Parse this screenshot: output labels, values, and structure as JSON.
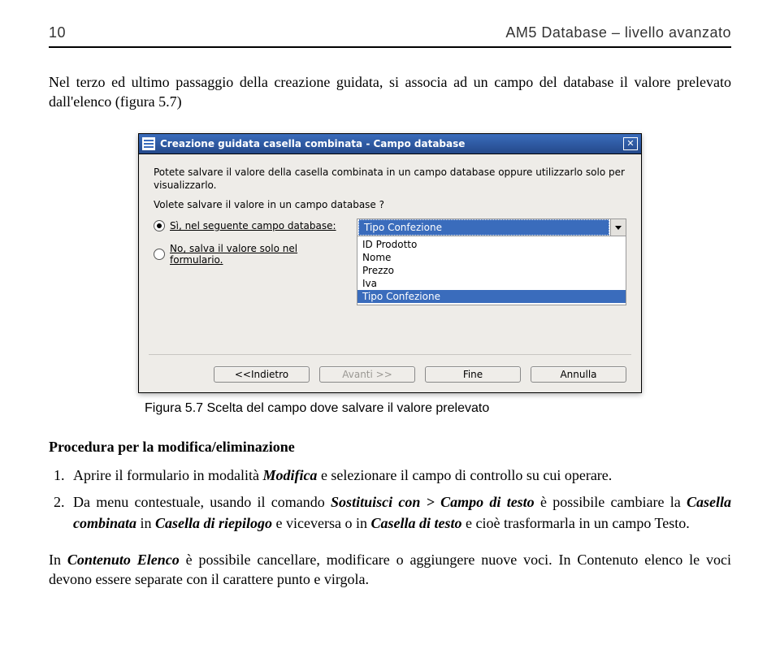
{
  "header": {
    "page_number": "10",
    "doc_title": "AM5 Database – livello avanzato"
  },
  "intro_paragraph": "Nel terzo ed ultimo passaggio della creazione guidata, si associa ad un campo del database il valore prelevato dall'elenco (figura 5.7)",
  "dialog": {
    "title": "Creazione guidata casella combinata - Campo database",
    "line1": "Potete salvare il valore della casella combinata in un campo database oppure utilizzarlo solo per visualizzarlo.",
    "line2": "Volete salvare il valore in un campo database ?",
    "radio_yes": "Sì, nel seguente campo database:",
    "radio_no": "No, salva il valore solo nel formulario.",
    "combo_selected": "Tipo Confezione",
    "combo_items": [
      "ID Prodotto",
      "Nome",
      "Prezzo",
      "Iva",
      "Tipo Confezione"
    ],
    "buttons": {
      "back": "<<Indietro",
      "next": "Avanti >>",
      "finish": "Fine",
      "cancel": "Annulla"
    }
  },
  "caption": "Figura 5.7 Scelta del campo dove salvare il valore prelevato",
  "procedure": {
    "heading": "Procedura per la modifica/eliminazione",
    "step1_a": "Aprire il formulario in modalità ",
    "step1_b": "Modifica",
    "step1_c": " e selezionare il campo di controllo su cui operare.",
    "step2_a": "Da menu contestuale, usando il comando ",
    "step2_b": "Sostituisci con > Campo di testo",
    "step2_c": " è possibile cambiare la ",
    "step2_d": "Casella combinata",
    "step2_e": " in ",
    "step2_f": "Casella di riepilogo",
    "step2_g": " e viceversa o in ",
    "step2_h": "Casella di testo",
    "step2_i": " e cioè trasformarla in un campo Testo."
  },
  "closing": {
    "a": "In ",
    "b": "Contenuto Elenco",
    "c": " è possibile cancellare, modificare o aggiungere nuove voci. In Contenuto elenco le voci devono essere separate con il carattere punto e virgola."
  }
}
